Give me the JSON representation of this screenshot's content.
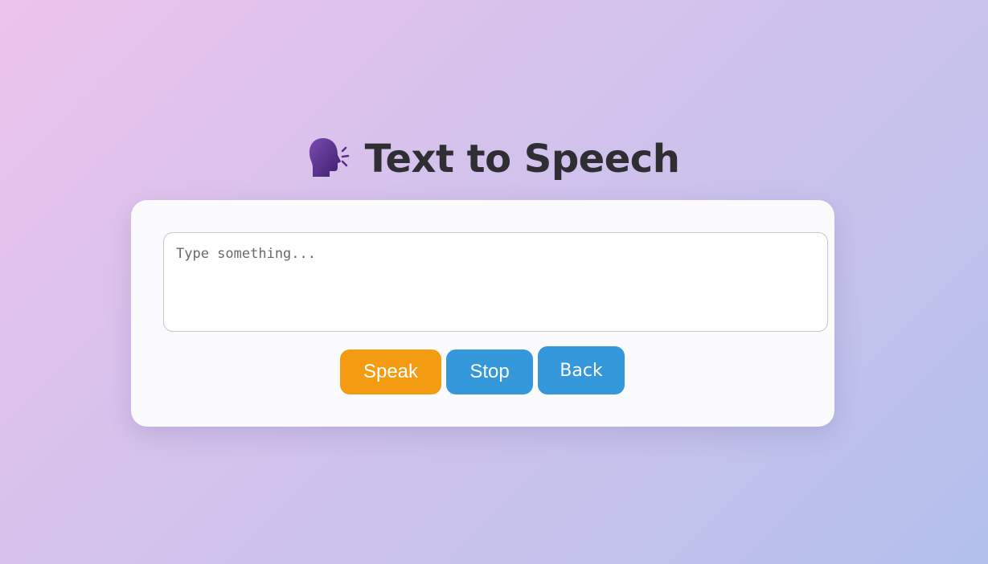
{
  "header": {
    "icon": "speaking-head-icon",
    "title": "Text to Speech"
  },
  "input": {
    "placeholder": "Type something...",
    "value": ""
  },
  "buttons": {
    "speak_label": "Speak",
    "stop_label": "Stop",
    "back_label": "Back"
  },
  "colors": {
    "speak": "#f39c12",
    "stop": "#3498db",
    "back": "#3498db",
    "title": "#2e2e33",
    "icon": "#5b2e8c"
  }
}
